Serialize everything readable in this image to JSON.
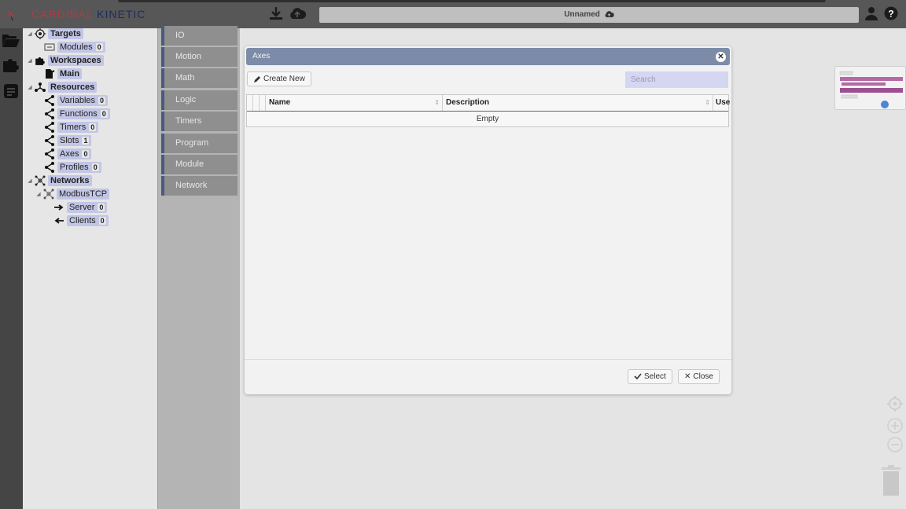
{
  "app": {
    "brand_part1": "CARDINAL",
    "brand_part2": "KINETIC",
    "project_title": "Unnamed",
    "colors": {
      "accent": "#7c8ba8",
      "tree_label": "#c2c6e6",
      "brand_red": "#b23a44",
      "brand_navy": "#1e2d5f",
      "category_border": "#4a5a80"
    }
  },
  "toolbar": {
    "icons": [
      "download-icon",
      "cloud-upload-icon",
      "user-icon",
      "help-icon"
    ]
  },
  "rail": {
    "icons": [
      "folder-open-icon",
      "puzzle-icon",
      "document-icon"
    ]
  },
  "tree": {
    "targets": {
      "label": "Targets",
      "modules": {
        "label": "Modules",
        "count": "0"
      }
    },
    "workspaces": {
      "label": "Workspaces",
      "main": {
        "label": "Main"
      }
    },
    "resources": {
      "label": "Resources",
      "items": [
        {
          "label": "Variables",
          "count": "0"
        },
        {
          "label": "Functions",
          "count": "0"
        },
        {
          "label": "Timers",
          "count": "0"
        },
        {
          "label": "Slots",
          "count": "1"
        },
        {
          "label": "Axes",
          "count": "0"
        },
        {
          "label": "Profiles",
          "count": "0"
        }
      ]
    },
    "networks": {
      "label": "Networks",
      "modbus": {
        "label": "ModbusTCP"
      },
      "server": {
        "label": "Server",
        "count": "0"
      },
      "clients": {
        "label": "Clients",
        "count": "0"
      }
    }
  },
  "categories": [
    "IO",
    "Motion",
    "Math",
    "Logic",
    "Timers",
    "Program",
    "Module",
    "Network"
  ],
  "modal": {
    "title": "Axes",
    "create_label": "Create New",
    "search_placeholder": "Search",
    "columns": {
      "name": "Name",
      "description": "Description",
      "use": "Use"
    },
    "empty_text": "Empty",
    "select_label": "Select",
    "close_label": "Close"
  }
}
